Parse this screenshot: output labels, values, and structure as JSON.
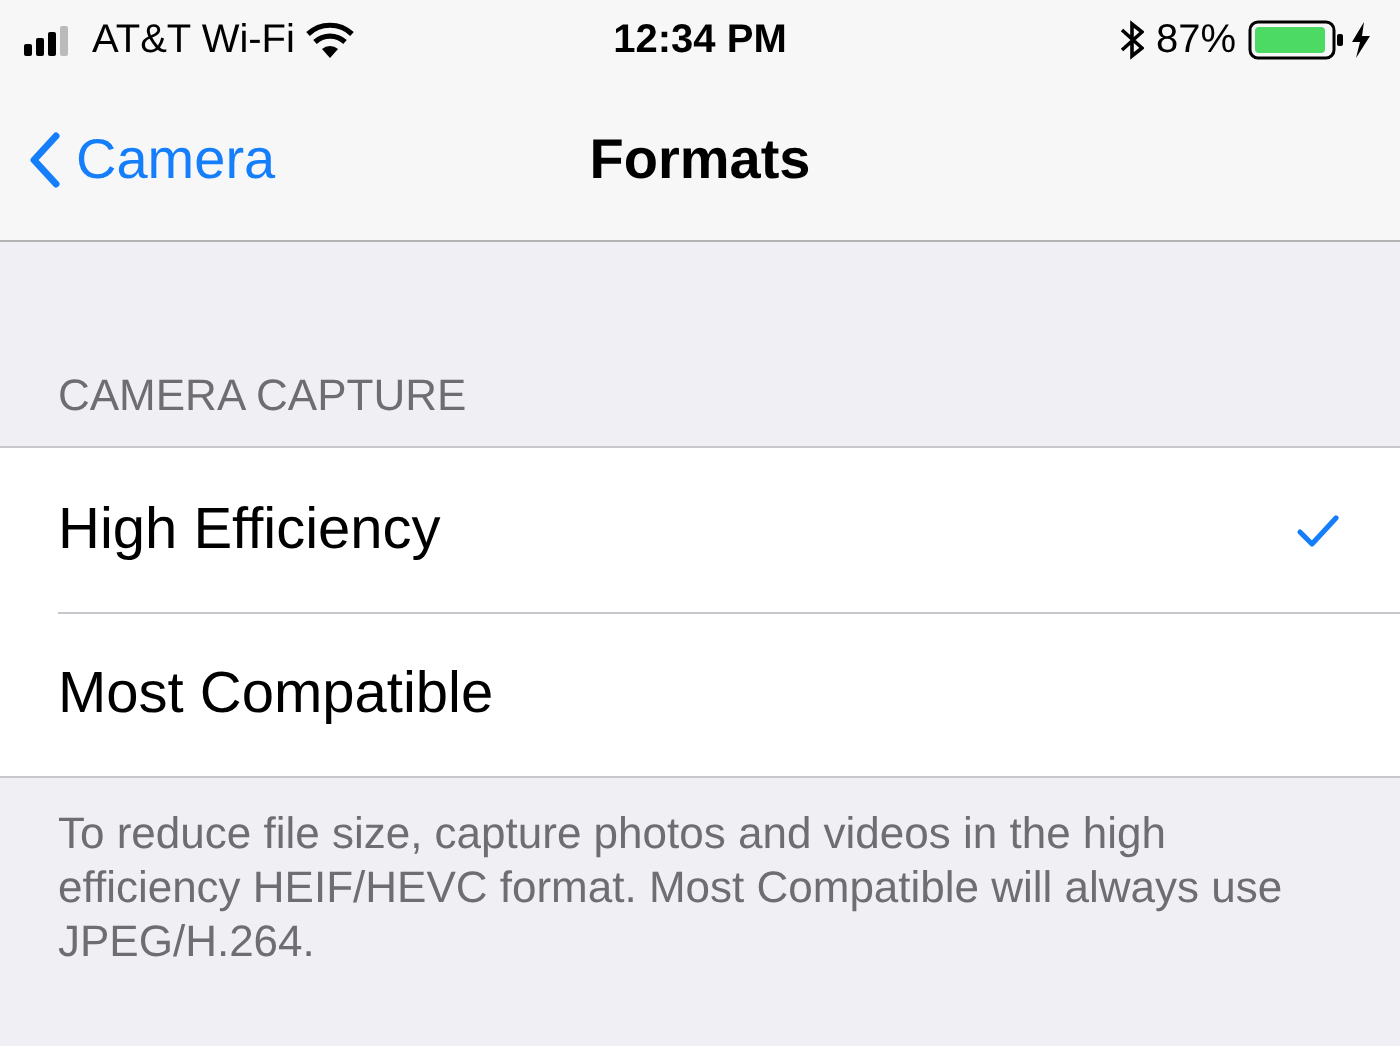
{
  "status_bar": {
    "carrier": "AT&T Wi-Fi",
    "time": "12:34 PM",
    "battery": "87%"
  },
  "nav_bar": {
    "back": "Camera",
    "title": "Formats"
  },
  "section": {
    "header": "CAMERA CAPTURE",
    "options": [
      {
        "label": "High Efficiency",
        "selected": true
      },
      {
        "label": "Most Compatible",
        "selected": false
      }
    ],
    "footer": "To reduce file size, capture photos and videos in the high efficiency HEIF/HEVC format. Most Compatible will always use JPEG/H.264."
  }
}
